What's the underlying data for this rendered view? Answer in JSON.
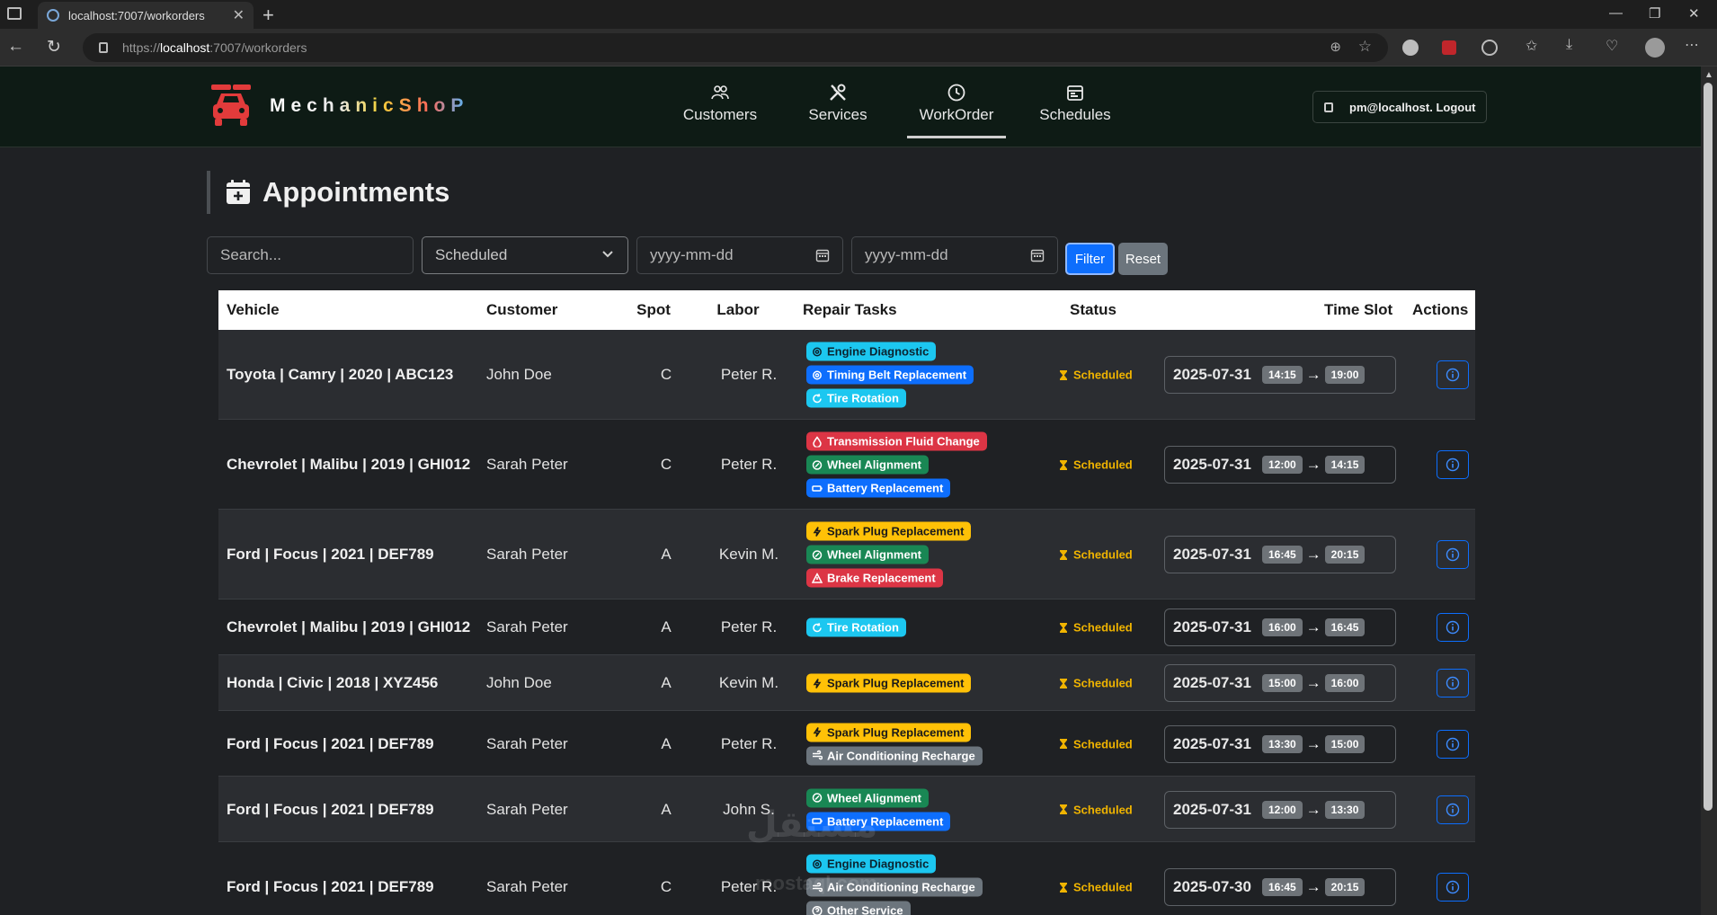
{
  "browser": {
    "tab_title": "localhost:7007/workorders",
    "url_prefix": "https://",
    "url_host": "localhost",
    "url_path": ":7007/workorders"
  },
  "header": {
    "brand": "MechanicShoP",
    "nav": [
      {
        "label": "Customers",
        "icon": "users-icon"
      },
      {
        "label": "Services",
        "icon": "tools-icon"
      },
      {
        "label": "WorkOrder",
        "icon": "clock-icon",
        "active": true
      },
      {
        "label": "Schedules",
        "icon": "calendar-icon"
      }
    ],
    "user_label": "pm@localhost. Logout"
  },
  "page": {
    "title": "Appointments"
  },
  "filters": {
    "search_placeholder": "Search...",
    "status_selected": "Scheduled",
    "date_from_placeholder": "yyyy-mm-dd",
    "date_to_placeholder": "yyyy-mm-dd",
    "filter_label": "Filter",
    "reset_label": "Reset"
  },
  "table": {
    "headers": [
      "Vehicle",
      "Customer",
      "Spot",
      "Labor",
      "Repair Tasks",
      "Status",
      "Time Slot",
      "Actions"
    ],
    "rows": [
      {
        "vehicle": "Toyota | Camry | 2020 | ABC123",
        "customer": "John Doe",
        "spot": "C",
        "labor": "Peter R.",
        "tasks": [
          "Engine Diagnostic",
          "Timing Belt Replacement",
          "Tire Rotation"
        ],
        "status": "Scheduled",
        "date": "2025-07-31",
        "start": "14:15",
        "end": "19:00"
      },
      {
        "vehicle": "Chevrolet | Malibu | 2019 | GHI012",
        "customer": "Sarah Peter",
        "spot": "C",
        "labor": "Peter R.",
        "tasks": [
          "Transmission Fluid Change",
          "Wheel Alignment",
          "Battery Replacement"
        ],
        "status": "Scheduled",
        "date": "2025-07-31",
        "start": "12:00",
        "end": "14:15"
      },
      {
        "vehicle": "Ford | Focus | 2021 | DEF789",
        "customer": "Sarah Peter",
        "spot": "A",
        "labor": "Kevin M.",
        "tasks": [
          "Spark Plug Replacement",
          "Wheel Alignment",
          "Brake Replacement"
        ],
        "status": "Scheduled",
        "date": "2025-07-31",
        "start": "16:45",
        "end": "20:15"
      },
      {
        "vehicle": "Chevrolet | Malibu | 2019 | GHI012",
        "customer": "Sarah Peter",
        "spot": "A",
        "labor": "Peter R.",
        "tasks": [
          "Tire Rotation"
        ],
        "status": "Scheduled",
        "date": "2025-07-31",
        "start": "16:00",
        "end": "16:45"
      },
      {
        "vehicle": "Honda | Civic | 2018 | XYZ456",
        "customer": "John Doe",
        "spot": "A",
        "labor": "Kevin M.",
        "tasks": [
          "Spark Plug Replacement"
        ],
        "status": "Scheduled",
        "date": "2025-07-31",
        "start": "15:00",
        "end": "16:00"
      },
      {
        "vehicle": "Ford | Focus | 2021 | DEF789",
        "customer": "Sarah Peter",
        "spot": "A",
        "labor": "Peter R.",
        "tasks": [
          "Spark Plug Replacement",
          "Air Conditioning Recharge"
        ],
        "status": "Scheduled",
        "date": "2025-07-31",
        "start": "13:30",
        "end": "15:00"
      },
      {
        "vehicle": "Ford | Focus | 2021 | DEF789",
        "customer": "Sarah Peter",
        "spot": "A",
        "labor": "John S.",
        "tasks": [
          "Wheel Alignment",
          "Battery Replacement"
        ],
        "status": "Scheduled",
        "date": "2025-07-31",
        "start": "12:00",
        "end": "13:30"
      },
      {
        "vehicle": "Ford | Focus | 2021 | DEF789",
        "customer": "Sarah Peter",
        "spot": "C",
        "labor": "Peter R.",
        "tasks": [
          "Engine Diagnostic",
          "Air Conditioning Recharge",
          "Other Service"
        ],
        "status": "Scheduled",
        "date": "2025-07-30",
        "start": "16:45",
        "end": "20:15"
      }
    ]
  },
  "task_styles": {
    "Engine Diagnostic": {
      "bg": "#1cc7f0",
      "fg": "#0b2430",
      "icon": "gear-icon"
    },
    "Timing Belt Replacement": {
      "bg": "#0d6efd",
      "fg": "#ffffff",
      "icon": "gear-icon"
    },
    "Tire Rotation": {
      "bg": "#1cc7f0",
      "fg": "#ffffff",
      "icon": "rotate-icon"
    },
    "Transmission Fluid Change": {
      "bg": "#dc3545",
      "fg": "#ffffff",
      "icon": "droplet-icon"
    },
    "Wheel Alignment": {
      "bg": "#198754",
      "fg": "#ffffff",
      "icon": "wheel-icon"
    },
    "Battery Replacement": {
      "bg": "#0d6efd",
      "fg": "#ffffff",
      "icon": "battery-icon"
    },
    "Spark Plug Replacement": {
      "bg": "#ffc107",
      "fg": "#1a1a1a",
      "icon": "bolt-icon"
    },
    "Brake Replacement": {
      "bg": "#dc3545",
      "fg": "#ffffff",
      "icon": "warning-icon"
    },
    "Air Conditioning Recharge": {
      "bg": "#6c757d",
      "fg": "#ffffff",
      "icon": "fan-icon"
    },
    "Other Service": {
      "bg": "#6c757d",
      "fg": "#ffffff",
      "icon": "question-icon"
    }
  },
  "colors": {
    "brand_red": "#e23b3b",
    "accent_blue": "#0d6efd",
    "status_yellow": "#f0b400"
  },
  "watermark": {
    "line1": "مستقل",
    "line2": "mostaql.com"
  }
}
